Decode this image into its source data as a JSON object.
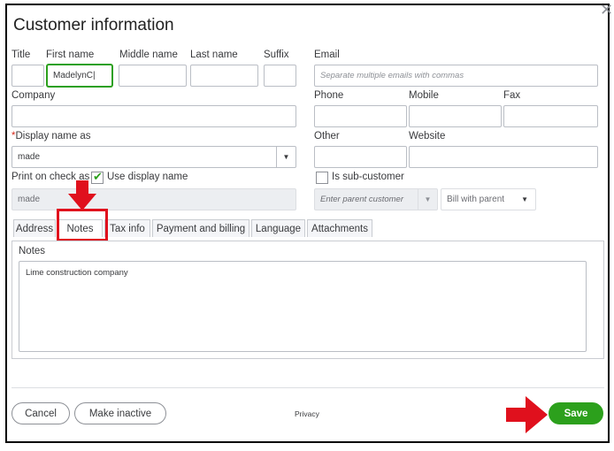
{
  "dialog": {
    "title": "Customer information",
    "close_glyph": "✕"
  },
  "name_fields": {
    "title_label": "Title",
    "title_value": "",
    "first_label": "First name",
    "first_value": "MadelynC|",
    "middle_label": "Middle name",
    "middle_value": "",
    "last_label": "Last name",
    "last_value": "",
    "suffix_label": "Suffix",
    "suffix_value": ""
  },
  "email": {
    "label": "Email",
    "placeholder": "Separate multiple emails with commas"
  },
  "company": {
    "label": "Company",
    "value": ""
  },
  "phones": {
    "phone_label": "Phone",
    "mobile_label": "Mobile",
    "fax_label": "Fax"
  },
  "display_name": {
    "required_mark": "*",
    "label": "Display name as",
    "value": "made"
  },
  "other": {
    "label": "Other",
    "website_label": "Website"
  },
  "print_on_check": {
    "label": "Print on check as",
    "checkbox_label": "Use display name",
    "checked": true,
    "value": "made"
  },
  "sub_customer": {
    "checkbox_label": "Is sub-customer",
    "checked": false,
    "parent_placeholder": "Enter parent customer",
    "bill_option": "Bill with parent"
  },
  "tabs": [
    {
      "label": "Address"
    },
    {
      "label": "Notes",
      "active": true
    },
    {
      "label": "Tax info"
    },
    {
      "label": "Payment and billing"
    },
    {
      "label": "Language"
    },
    {
      "label": "Attachments"
    }
  ],
  "notes": {
    "label": "Notes",
    "value": "Lime construction company"
  },
  "footer": {
    "cancel_label": "Cancel",
    "make_inactive_label": "Make inactive",
    "privacy_label": "Privacy",
    "save_label": "Save"
  },
  "icons": {
    "checkmark": "✔",
    "caret": "▼"
  },
  "colors": {
    "accent_green": "#2ca01c",
    "annotation_red": "#e0101d",
    "required_red": "#d52b1e"
  }
}
